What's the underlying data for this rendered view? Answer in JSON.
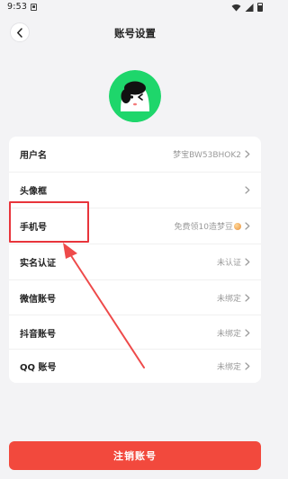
{
  "status_bar": {
    "time": "9:53"
  },
  "header": {
    "title": "账号设置"
  },
  "settings": {
    "rows": [
      {
        "label": "用户名",
        "value": "梦宝BW53BHOK2"
      },
      {
        "label": "头像框",
        "value": ""
      },
      {
        "label": "手机号",
        "value": "免费领10造梦豆"
      },
      {
        "label": "实名认证",
        "value": "未认证"
      },
      {
        "label": "微信账号",
        "value": "未绑定"
      },
      {
        "label": "抖音账号",
        "value": "未绑定"
      },
      {
        "label": "QQ 账号",
        "value": "未绑定"
      }
    ]
  },
  "footer": {
    "cancel_account_label": "注销账号"
  },
  "colors": {
    "accent": "#f2493d",
    "annotation": "#e8343b",
    "avatar_ring": "#1ed66b"
  },
  "icons": {
    "back": "chevron-left-icon",
    "row": "chevron-right-icon",
    "coin": "coin-icon"
  }
}
